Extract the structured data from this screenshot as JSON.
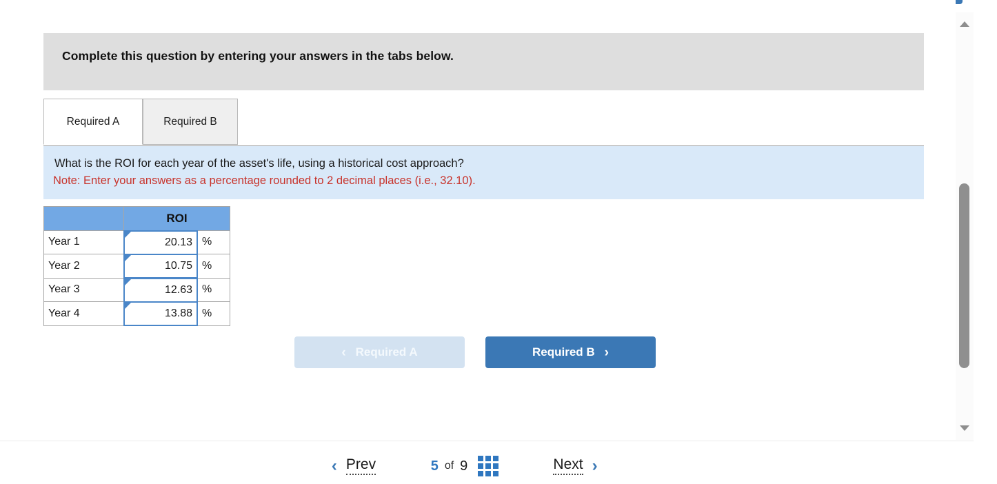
{
  "top_button": {
    "label": ""
  },
  "banner": {
    "text": "Complete this question by entering your answers in the tabs below."
  },
  "tabs": [
    {
      "label": "Required A",
      "active": true
    },
    {
      "label": "Required B",
      "active": false
    }
  ],
  "question": {
    "prompt": "What is the ROI for each year of the asset's life, using a historical cost approach?",
    "note": "Note: Enter your answers as a percentage rounded to 2 decimal places (i.e., 32.10)."
  },
  "answer_table": {
    "headers": [
      "",
      "ROI"
    ],
    "unit": "%",
    "rows": [
      {
        "label": "Year 1",
        "value": "20.13",
        "unit": "%"
      },
      {
        "label": "Year 2",
        "value": "10.75",
        "unit": "%"
      },
      {
        "label": "Year 3",
        "value": "12.63",
        "unit": "%"
      },
      {
        "label": "Year 4",
        "value": "13.88",
        "unit": "%"
      }
    ]
  },
  "req_nav": {
    "prev_label": "Required A",
    "prev_chevron": "‹",
    "next_label": "Required B",
    "next_chevron": "›"
  },
  "pager": {
    "prev_label": "Prev",
    "prev_chevron": "‹",
    "current_page": "5",
    "of_label": "of",
    "total_pages": "9",
    "next_label": "Next",
    "next_chevron": "›"
  },
  "colors": {
    "banner_bg": "#dedede",
    "question_bg": "#d9e9f9",
    "note_red": "#c8332b",
    "table_header_blue": "#72a8e4",
    "input_border_blue": "#4a86c8",
    "primary_blue": "#3b78b5",
    "disabled_blue": "#d3e2f1",
    "link_blue": "#2f77c0",
    "scrollbar_thumb": "#8f8f8f"
  }
}
